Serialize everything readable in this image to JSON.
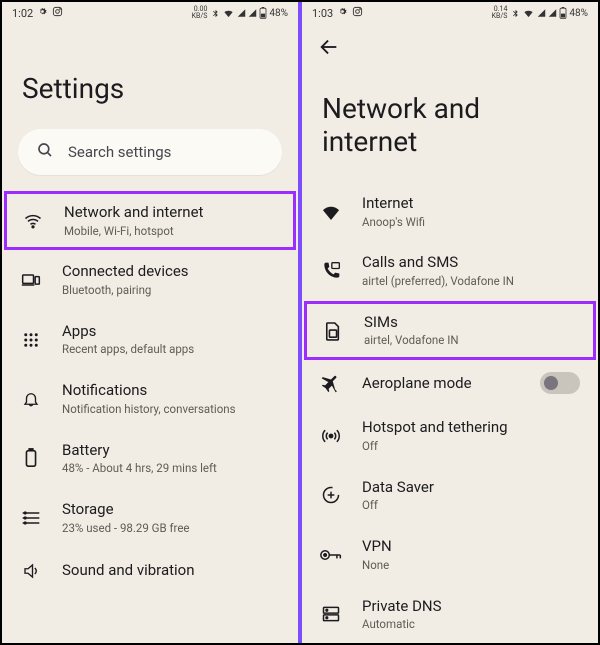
{
  "left": {
    "status": {
      "time": "1:02",
      "net": "0.00",
      "battery": "48%"
    },
    "title": "Settings",
    "search_placeholder": "Search settings",
    "items": [
      {
        "title": "Network and internet",
        "subtitle": "Mobile, Wi-Fi, hotspot"
      },
      {
        "title": "Connected devices",
        "subtitle": "Bluetooth, pairing"
      },
      {
        "title": "Apps",
        "subtitle": "Recent apps, default apps"
      },
      {
        "title": "Notifications",
        "subtitle": "Notification history, conversations"
      },
      {
        "title": "Battery",
        "subtitle": "48% - About 4 hrs, 29 mins left"
      },
      {
        "title": "Storage",
        "subtitle": "23% used - 98.29 GB free"
      },
      {
        "title": "Sound and vibration",
        "subtitle": ""
      }
    ]
  },
  "right": {
    "status": {
      "time": "1:03",
      "net": "0.14",
      "battery": "48%"
    },
    "title": "Network and internet",
    "items": [
      {
        "title": "Internet",
        "subtitle": "Anoop's Wifi"
      },
      {
        "title": "Calls and SMS",
        "subtitle": "airtel (preferred), Vodafone IN"
      },
      {
        "title": "SIMs",
        "subtitle": "airtel, Vodafone IN"
      },
      {
        "title": "Aeroplane mode",
        "subtitle": ""
      },
      {
        "title": "Hotspot and tethering",
        "subtitle": "Off"
      },
      {
        "title": "Data Saver",
        "subtitle": "Off"
      },
      {
        "title": "VPN",
        "subtitle": "None"
      },
      {
        "title": "Private DNS",
        "subtitle": "Automatic"
      }
    ]
  }
}
